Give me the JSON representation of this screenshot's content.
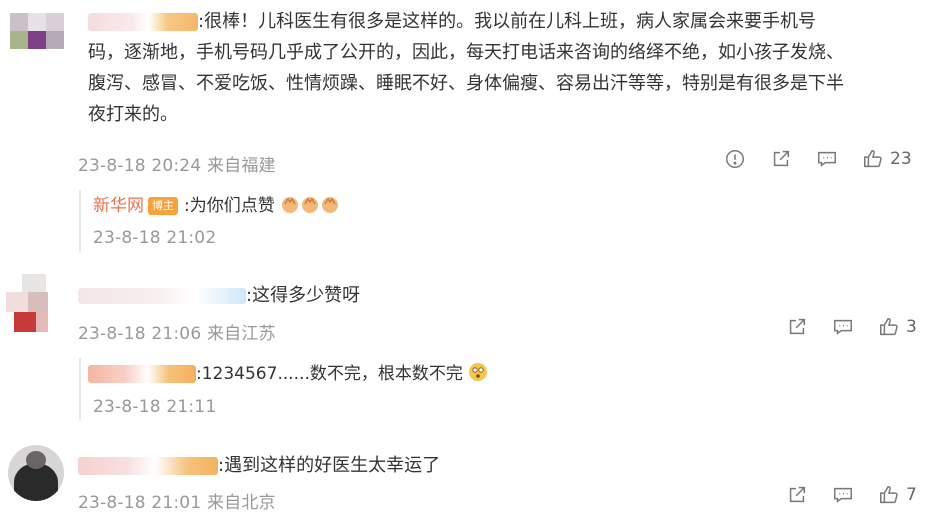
{
  "comments": [
    {
      "text_lines": [
        ":很棒！儿科医生有很多是这样的。我以前在儿科上班，病人家属会来要手机号",
        "码，逐渐地，手机号码几乎成了公开的，因此，每天打电话来咨询的络绎不绝，如小孩子发烧、",
        "腹泻、感冒、不爱吃饭、性情烦躁、睡眠不好、身体偏瘦、容易出汗等等，特别是有很多是下半",
        "夜打来的。"
      ],
      "meta": "23-8-18 20:24 来自福建",
      "likes": "23",
      "reply": {
        "name": "新华网",
        "badge": "博主",
        "text": ":为你们点赞",
        "time": "23-8-18 21:02"
      }
    },
    {
      "text": ":这得多少赞呀",
      "meta": "23-8-18 21:06 来自江苏",
      "likes": "3",
      "reply": {
        "text": ":1234567......数不完，根本数不完",
        "time": "23-8-18 21:11"
      }
    },
    {
      "text": ":遇到这样的好医生太幸运了",
      "meta": "23-8-18 21:01 来自北京",
      "likes": "7"
    }
  ],
  "icons": [
    "report-icon",
    "share-icon",
    "comment-icon",
    "like-icon",
    "clap-emoji",
    "surprised-emoji"
  ],
  "colors": {
    "meta": "#999999",
    "reply_name": "#eb7350",
    "badge": "#f7a23a"
  }
}
